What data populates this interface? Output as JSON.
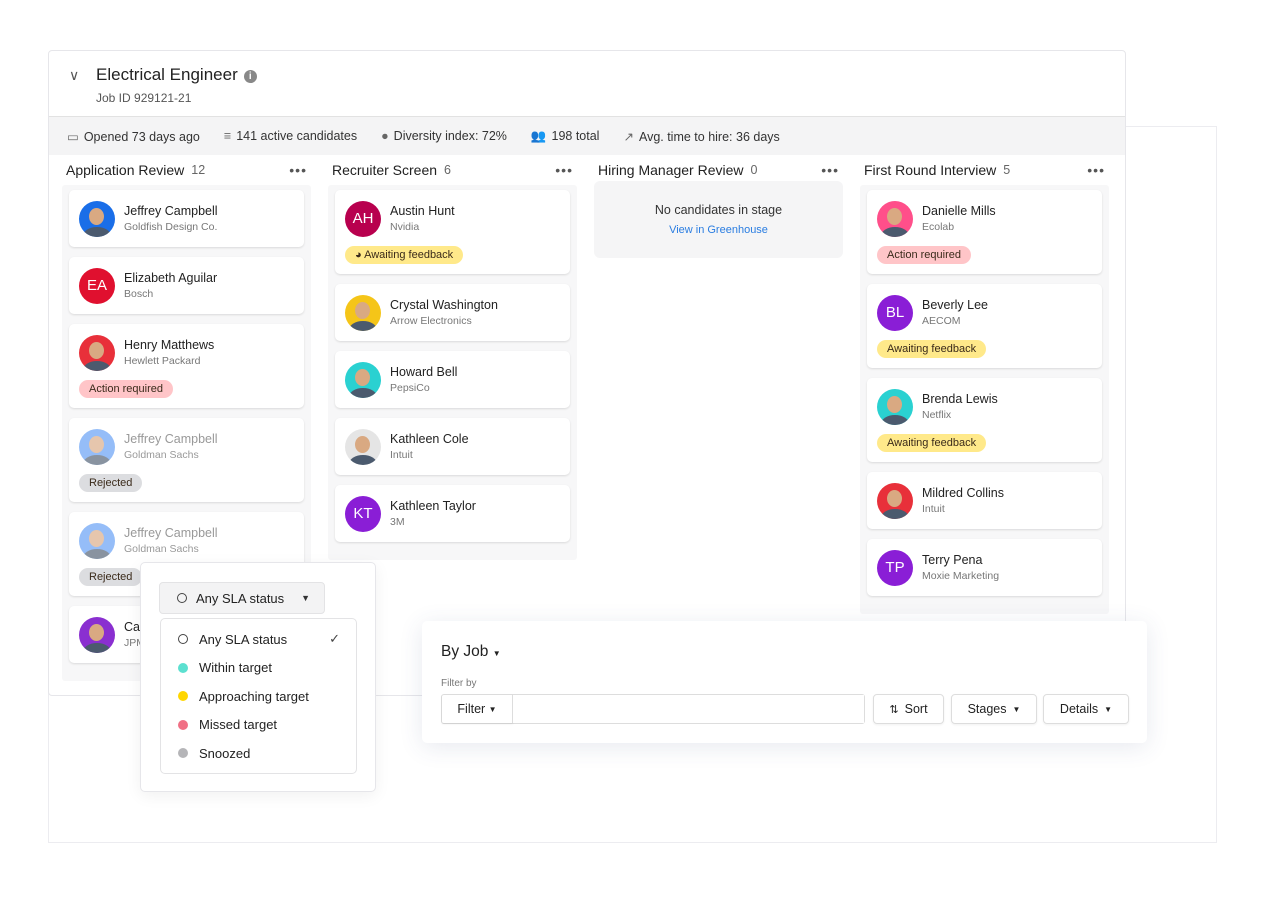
{
  "job": {
    "title": "Electrical Engineer",
    "job_id": "Job ID 929121-21"
  },
  "stats": [
    {
      "icon": "calendar-icon",
      "glyph": "▭",
      "label": "Opened 73 days ago"
    },
    {
      "icon": "filter-icon",
      "glyph": "≡",
      "label": "141 active candidates"
    },
    {
      "icon": "diversity-icon",
      "glyph": "●",
      "label": "Diversity index: 72%"
    },
    {
      "icon": "people-icon",
      "glyph": "👥",
      "label": "198 total"
    },
    {
      "icon": "trend-icon",
      "glyph": "↗",
      "label": "Avg. time to hire: 36 days"
    }
  ],
  "columns": [
    {
      "title": "Application Review",
      "count": "12",
      "cards": [
        {
          "name": "Jeffrey Campbell",
          "company": "Goldfish Design Co.",
          "avatar": "photo",
          "color": "#1a6ee8"
        },
        {
          "name": "Elizabeth Aguilar",
          "company": "Bosch",
          "avatar": "EA",
          "color": "#e0102f"
        },
        {
          "name": "Henry Matthews",
          "company": "Hewlett Packard",
          "avatar": "photo",
          "color": "#e8303a",
          "badge": "Action required",
          "badge_type": "action"
        },
        {
          "name": "Jeffrey Campbell",
          "company": "Goldman Sachs",
          "avatar": "photo",
          "color": "#5d9bf5",
          "badge": "Rejected",
          "badge_type": "rej",
          "dim": true
        },
        {
          "name": "Jeffrey Campbell",
          "company": "Goldman Sachs",
          "avatar": "photo",
          "color": "#5d9bf5",
          "badge": "Rejected",
          "badge_type": "rej",
          "dim": true
        },
        {
          "name": "Catherine",
          "company": "JPMorgan",
          "avatar": "photo",
          "color": "#8a2fd0"
        }
      ]
    },
    {
      "title": "Recruiter Screen",
      "count": "6",
      "cards": [
        {
          "name": "Austin Hunt",
          "company": "Nvidia",
          "avatar": "AH",
          "color": "#b8004e",
          "badge": "Awaiting feedback",
          "badge_type": "await",
          "badge_icon": true
        },
        {
          "name": "Crystal Washington",
          "company": "Arrow Electronics",
          "avatar": "photo",
          "color": "#f5c518"
        },
        {
          "name": "Howard Bell",
          "company": "PepsiCo",
          "avatar": "photo",
          "color": "#2ad1d1"
        },
        {
          "name": "Kathleen Cole",
          "company": "Intuit",
          "avatar": "photo",
          "color": "#e5e5e5"
        },
        {
          "name": "Kathleen Taylor",
          "company": "3M",
          "avatar": "KT",
          "color": "#8a1ed6"
        }
      ]
    },
    {
      "title": "Hiring Manager Review",
      "count": "0",
      "cards": [],
      "empty": "No candidates in stage",
      "empty_link": "View in Greenhouse"
    },
    {
      "title": "First Round Interview",
      "count": "5",
      "cards": [
        {
          "name": "Danielle Mills",
          "company": "Ecolab",
          "avatar": "photo",
          "color": "#ff4f8a",
          "badge": "Action required",
          "badge_type": "action"
        },
        {
          "name": "Beverly Lee",
          "company": "AECOM",
          "avatar": "BL",
          "color": "#8a1ed6",
          "badge": "Awaiting feedback",
          "badge_type": "await"
        },
        {
          "name": "Brenda Lewis",
          "company": "Netflix",
          "avatar": "photo",
          "color": "#2ad1d1",
          "badge": "Awaiting feedback",
          "badge_type": "await"
        },
        {
          "name": "Mildred Collins",
          "company": "Intuit",
          "avatar": "photo",
          "color": "#e8303a"
        },
        {
          "name": "Terry Pena",
          "company": "Moxie Marketing",
          "avatar": "TP",
          "color": "#8a1ed6"
        }
      ]
    }
  ],
  "sla": {
    "selected": "Any SLA status",
    "options": [
      {
        "label": "Any SLA status",
        "color": "",
        "checked": true
      },
      {
        "label": "Within target",
        "color": "#5ce0d0"
      },
      {
        "label": "Approaching target",
        "color": "#ffd600"
      },
      {
        "label": "Missed target",
        "color": "#f07085"
      },
      {
        "label": "Snoozed",
        "color": "#b5b5b8"
      }
    ]
  },
  "by_job": {
    "title": "By Job",
    "filter_by": "Filter by",
    "filter": "Filter",
    "filter_value": "",
    "sort": "Sort",
    "stages": "Stages",
    "details": "Details"
  }
}
